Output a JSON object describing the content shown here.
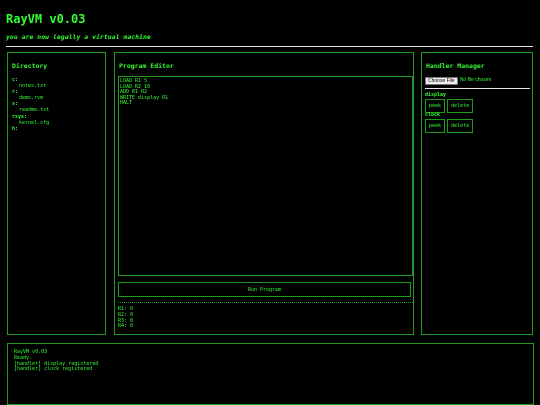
{
  "header": {
    "title": "RayVM v0.03",
    "tagline": "you are now legally a virtual machine"
  },
  "directory": {
    "title": "Directory",
    "drives": [
      {
        "name": "c:",
        "files": [
          "notes.txt"
        ]
      },
      {
        "name": "r:",
        "files": [
          "demo.rvm"
        ]
      },
      {
        "name": "s:",
        "files": [
          "readme.txt"
        ]
      },
      {
        "name": "rsys:",
        "files": [
          "kernel.cfg"
        ]
      },
      {
        "name": "h:",
        "files": []
      }
    ]
  },
  "editor": {
    "title": "Program Editor",
    "code": "LOAD R1 5\nLOAD R2 10\nADD R1 R2\nWRITE display R1\nHALT",
    "run_label": "Run Program",
    "registers": [
      "R1: 0",
      "R2: 0",
      "R3: 0",
      "R4: 0"
    ]
  },
  "handlers": {
    "title": "Handler Manager",
    "choose_file_label": "Choose File",
    "file_status": "No file chosen",
    "items": [
      {
        "name": "display",
        "peek_label": "peek",
        "delete_label": "delete"
      },
      {
        "name": "clock",
        "peek_label": "peek",
        "delete_label": "delete"
      }
    ]
  },
  "console": {
    "lines": [
      "RayVM v0.03",
      "Ready.",
      "[handler] display registered",
      "[handler] clock registered"
    ]
  },
  "colors": {
    "background": "#000000",
    "text": "#33ff33",
    "border": "#1f9a1f",
    "rule": "#e6e6e6"
  }
}
